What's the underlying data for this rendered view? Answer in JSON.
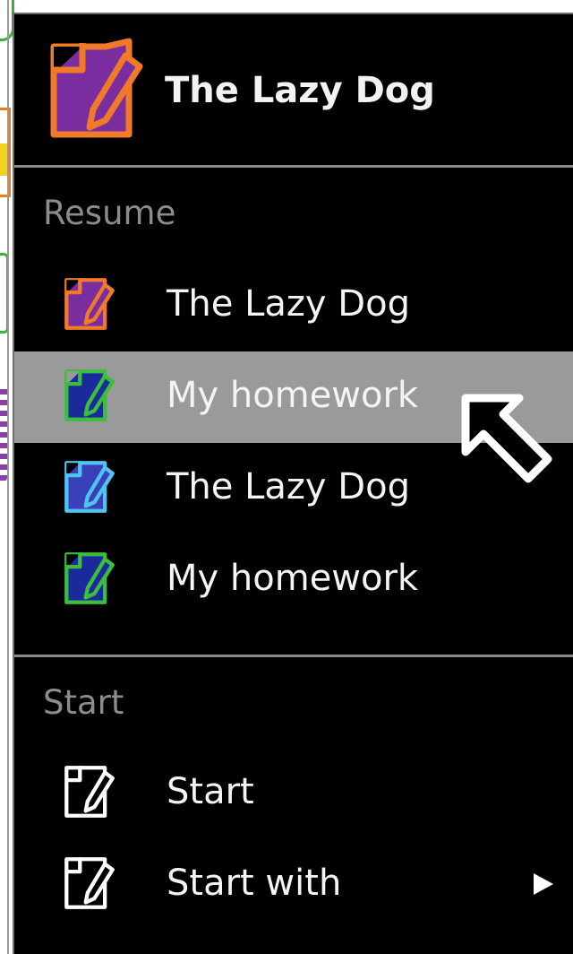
{
  "header": {
    "title": "The Lazy Dog",
    "icon": "document-pen-icon"
  },
  "resume": {
    "label": "Resume",
    "items": [
      {
        "label": "The Lazy Dog",
        "icon": "document-pen-icon",
        "fill": "#7a2d9e",
        "stroke": "#f07a2a"
      },
      {
        "label": "My homework",
        "icon": "document-pen-icon",
        "fill": "#1a2a9c",
        "stroke": "#3bbf3b",
        "hovered": true
      },
      {
        "label": "The Lazy Dog",
        "icon": "document-pen-icon",
        "fill": "#3a40b8",
        "stroke": "#4fc4ee"
      },
      {
        "label": "My homework",
        "icon": "document-pen-icon",
        "fill": "#1a2a9c",
        "stroke": "#3bbf3b"
      }
    ]
  },
  "start": {
    "label": "Start",
    "items": [
      {
        "label": "Start",
        "icon": "blank-document-pen-icon"
      },
      {
        "label": "Start with",
        "icon": "blank-document-pen-icon",
        "submenu_icon": "submenu-arrow-icon"
      }
    ]
  },
  "colors": {
    "menu_background": "#000000",
    "hover_background": "#9a9a9a",
    "section_label": "#8c8c8c",
    "divider": "#8a8a8a"
  },
  "cursor": {
    "icon": "mouse-pointer-icon"
  }
}
